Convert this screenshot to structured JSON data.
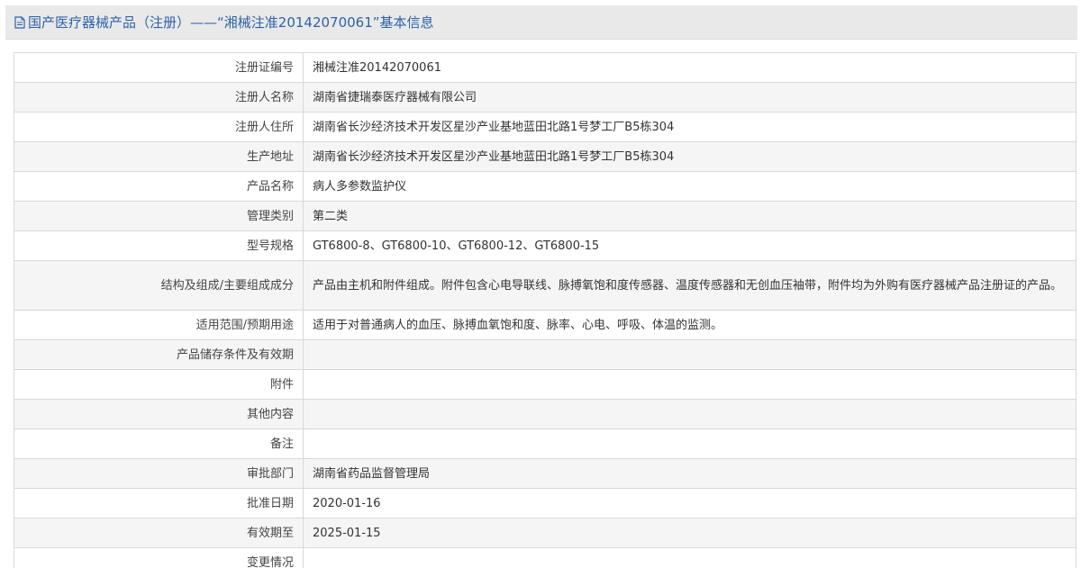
{
  "header": {
    "title": "国产医疗器械产品（注册）——“湘械注准20142070061”基本信息",
    "icon": "document-icon"
  },
  "rows": [
    {
      "label": "注册证编号",
      "value": "湘械注准20142070061"
    },
    {
      "label": "注册人名称",
      "value": "湖南省捷瑞泰医疗器械有限公司"
    },
    {
      "label": "注册人住所",
      "value": "湖南省长沙经济技术开发区星沙产业基地蓝田北路1号梦工厂B5栋304"
    },
    {
      "label": "生产地址",
      "value": "湖南省长沙经济技术开发区星沙产业基地蓝田北路1号梦工厂B5栋304"
    },
    {
      "label": "产品名称",
      "value": "病人多参数监护仪"
    },
    {
      "label": "管理类别",
      "value": "第二类"
    },
    {
      "label": "型号规格",
      "value": "GT6800-8、GT6800-10、GT6800-12、GT6800-15"
    },
    {
      "label": "结构及组成/主要组成成分",
      "value": "产品由主机和附件组成。附件包含心电导联线、脉搏氧饱和度传感器、温度传感器和无创血压袖带，附件均为外购有医疗器械产品注册证的产品。"
    },
    {
      "label": "适用范围/预期用途",
      "value": "适用于对普通病人的血压、脉搏血氧饱和度、脉率、心电、呼吸、体温的监测。"
    },
    {
      "label": "产品储存条件及有效期",
      "value": ""
    },
    {
      "label": "附件",
      "value": ""
    },
    {
      "label": "其他内容",
      "value": ""
    },
    {
      "label": "备注",
      "value": ""
    },
    {
      "label": "审批部门",
      "value": "湖南省药品监督管理局"
    },
    {
      "label": "批准日期",
      "value": "2020-01-16"
    },
    {
      "label": "有效期至",
      "value": "2025-01-15"
    },
    {
      "label": "变更情况",
      "value": ""
    }
  ],
  "colors": {
    "title": "#2e62a8",
    "header_bg": "#e9e9e9",
    "row_alt": "#f5f5f5",
    "border": "#d8d8d8"
  }
}
